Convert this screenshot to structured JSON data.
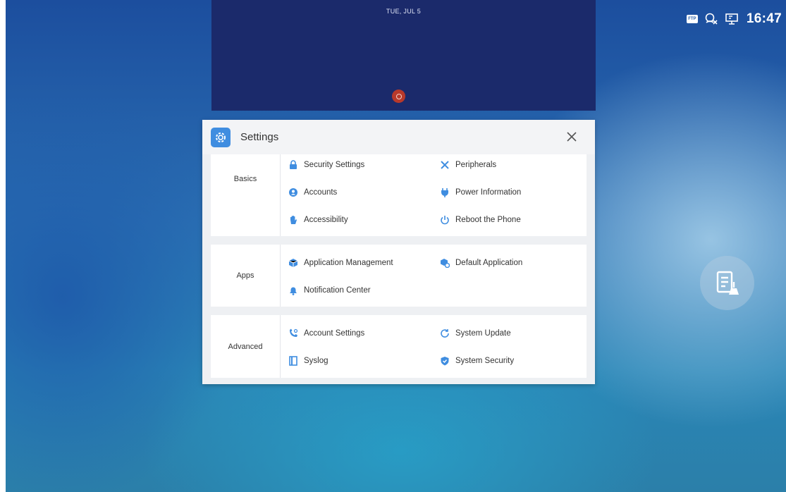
{
  "status_bar": {
    "ftp_label": "FTP",
    "time": "16:47"
  },
  "lock_preview": {
    "date": "TUE, JUL 5"
  },
  "window": {
    "title": "Settings",
    "close_icon": "close-icon"
  },
  "sections": [
    {
      "label": "Basics",
      "items": [
        {
          "label": "Security Settings",
          "icon": "lock-icon"
        },
        {
          "label": "Peripherals",
          "icon": "tools-icon"
        },
        {
          "label": "Accounts",
          "icon": "account-icon"
        },
        {
          "label": "Power Information",
          "icon": "plug-icon"
        },
        {
          "label": "Accessibility",
          "icon": "hand-icon"
        },
        {
          "label": "Reboot the Phone",
          "icon": "power-icon"
        }
      ]
    },
    {
      "label": "Apps",
      "items": [
        {
          "label": "Application Management",
          "icon": "cube-icon"
        },
        {
          "label": "Default Application",
          "icon": "cube-gear-icon"
        },
        {
          "label": "Notification Center",
          "icon": "bell-icon"
        }
      ]
    },
    {
      "label": "Advanced",
      "items": [
        {
          "label": "Account Settings",
          "icon": "phone-icon"
        },
        {
          "label": "System Update",
          "icon": "refresh-icon"
        },
        {
          "label": "Syslog",
          "icon": "log-icon"
        },
        {
          "label": "System Security",
          "icon": "shield-icon"
        }
      ]
    }
  ],
  "colors": {
    "accent": "#3f8de0",
    "lock_bg": "#1b2a6b",
    "lock_dot": "#b8392b"
  }
}
